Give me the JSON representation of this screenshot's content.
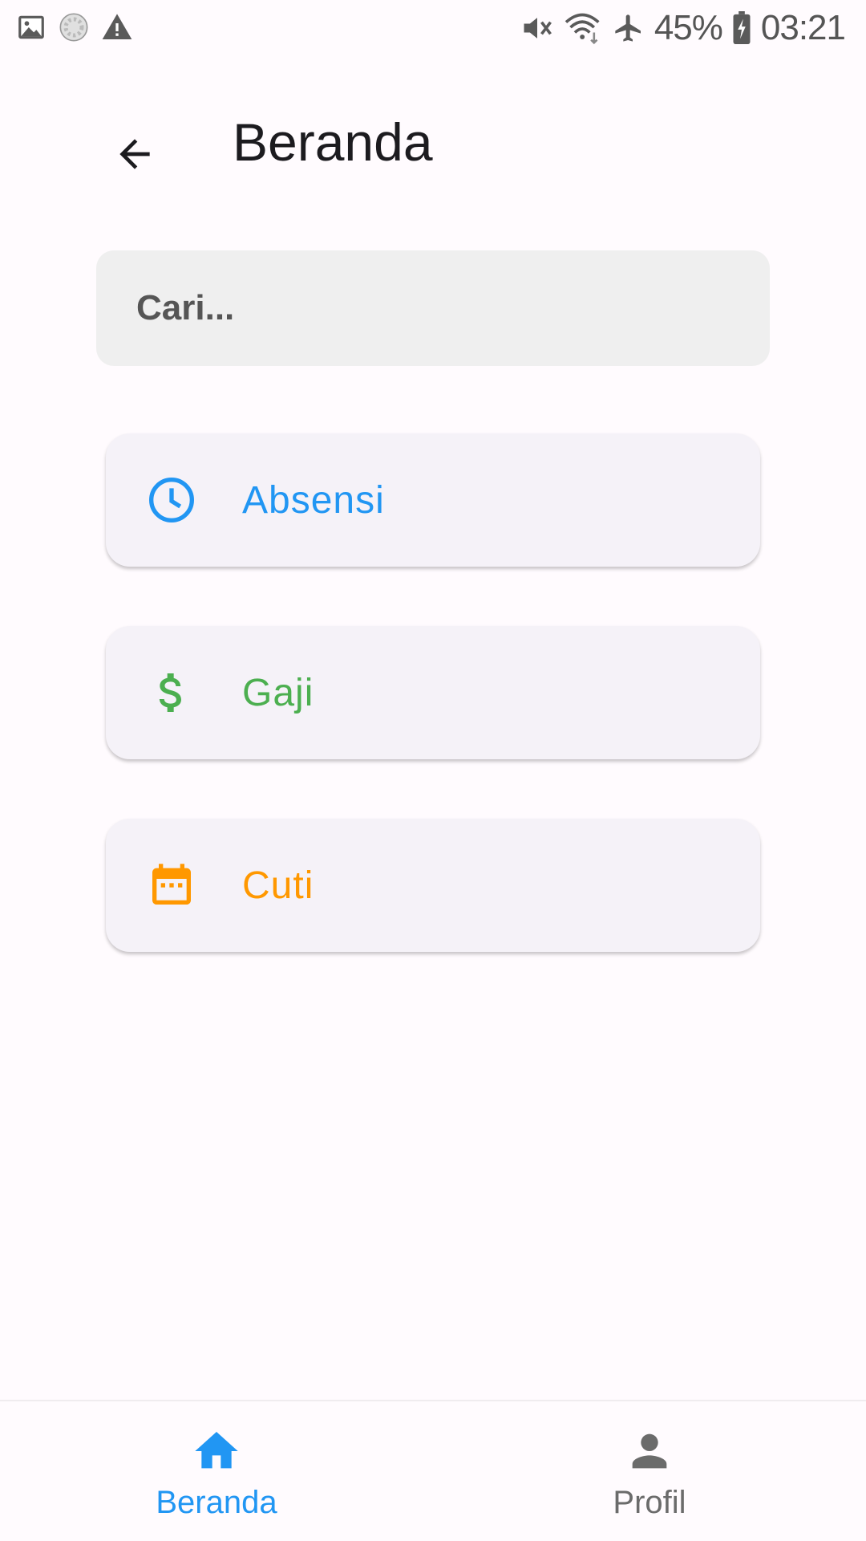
{
  "status_bar": {
    "icons_left": [
      "image-icon",
      "loading-icon",
      "warning-icon"
    ],
    "icons_right": [
      "vibrate-icon",
      "wifi-icon",
      "airplane-icon"
    ],
    "battery": "45%",
    "time": "03:21"
  },
  "app_bar": {
    "back_icon": "arrow-back-icon",
    "title": "Beranda"
  },
  "search": {
    "placeholder": "Cari...",
    "value": ""
  },
  "menu": [
    {
      "label": "Absensi",
      "icon": "clock-icon",
      "color": "#2196f3"
    },
    {
      "label": "Gaji",
      "icon": "dollar-icon",
      "color": "#4caf50"
    },
    {
      "label": "Cuti",
      "icon": "calendar-icon",
      "color": "#ff9800"
    }
  ],
  "bottom_nav": {
    "items": [
      {
        "label": "Beranda",
        "icon": "home-icon",
        "active": true,
        "color": "#2196f3"
      },
      {
        "label": "Profil",
        "icon": "person-icon",
        "active": false,
        "color": "#6b6b6b"
      }
    ]
  }
}
